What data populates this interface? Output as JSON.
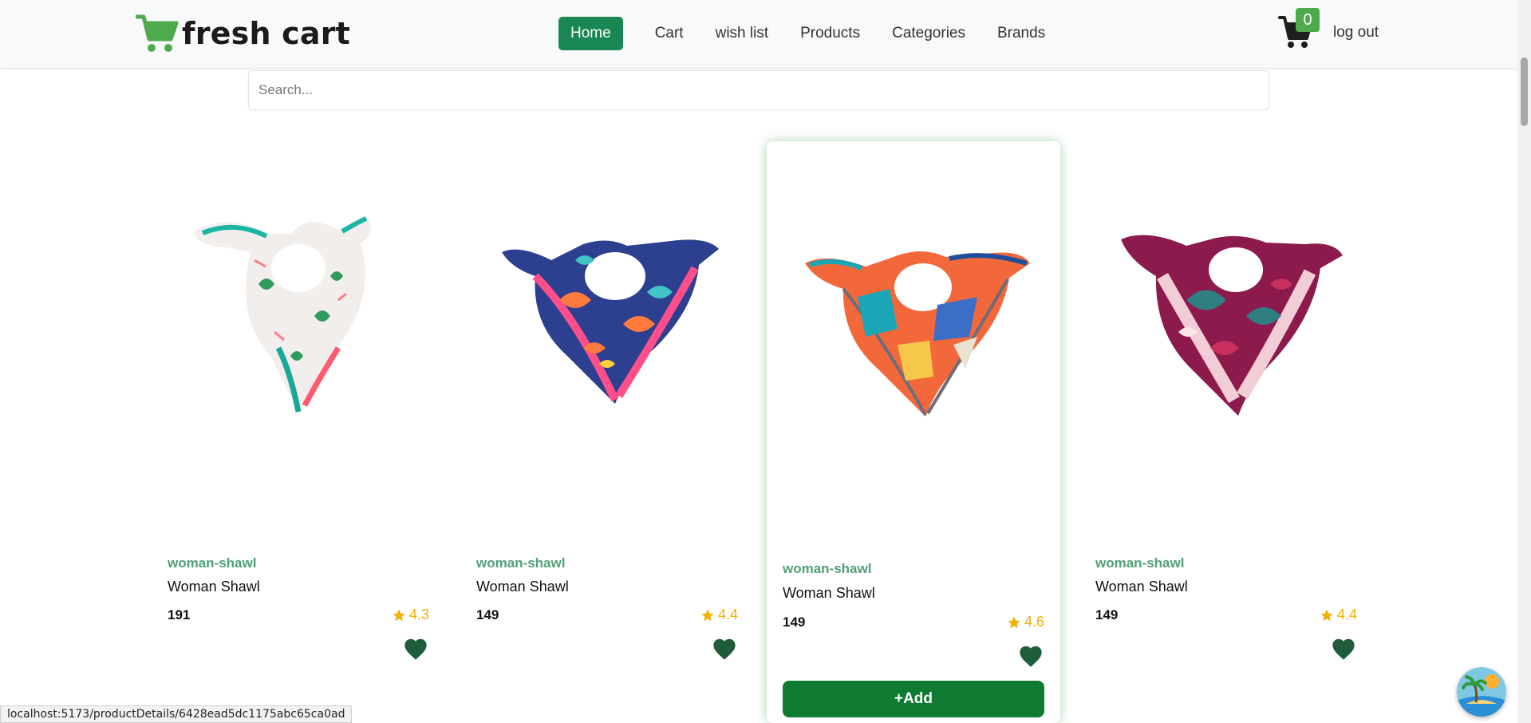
{
  "nav": {
    "brand": "fresh cart",
    "links": [
      {
        "label": "Home",
        "active": true
      },
      {
        "label": "Cart"
      },
      {
        "label": "wish list"
      },
      {
        "label": "Products"
      },
      {
        "label": "Categories"
      },
      {
        "label": "Brands"
      }
    ],
    "cart_count": "0",
    "logout": "log out",
    "brand_color": "#4fa94d",
    "active_color": "#198754"
  },
  "search": {
    "placeholder": "Search..."
  },
  "products": [
    {
      "category": "woman-shawl",
      "title": "Woman Shawl",
      "price": "191",
      "rating": "4.3"
    },
    {
      "category": "woman-shawl",
      "title": "Woman Shawl",
      "price": "149",
      "rating": "4.4"
    },
    {
      "category": "woman-shawl",
      "title": "Woman Shawl",
      "price": "149",
      "rating": "4.6",
      "add_label": "+Add"
    },
    {
      "category": "woman-shawl",
      "title": "Woman Shawl",
      "price": "149",
      "rating": "4.4"
    }
  ],
  "status_url": "localhost:5173/productDetails/6428ead5dc1175abc65ca0ad"
}
